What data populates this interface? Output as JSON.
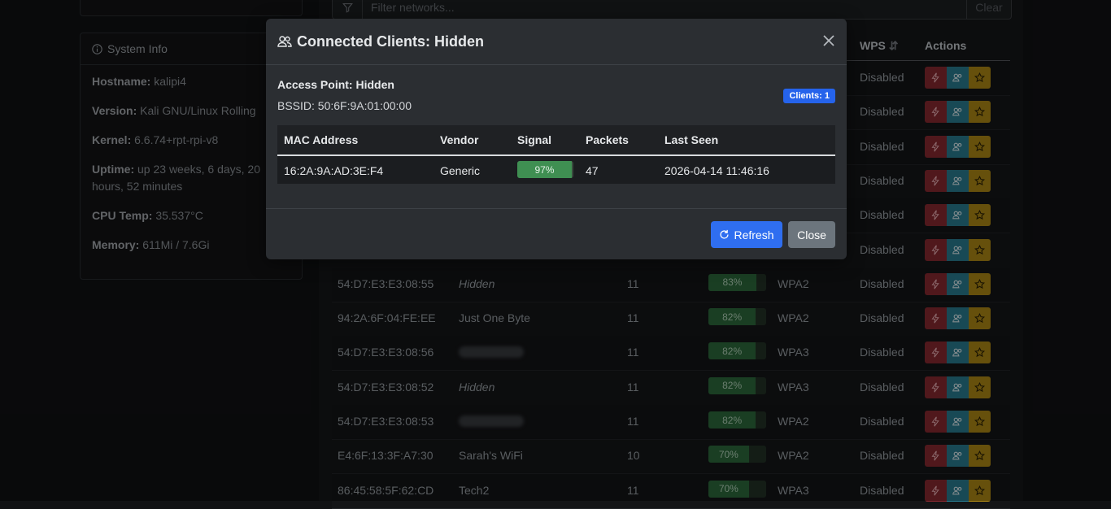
{
  "filter": {
    "placeholder": "Filter networks...",
    "clear_label": "Clear"
  },
  "sysinfo": {
    "title": "System Info",
    "rows": [
      {
        "label": "Hostname:",
        "value": "kalipi4"
      },
      {
        "label": "Version:",
        "value": "Kali GNU/Linux Rolling"
      },
      {
        "label": "Kernel:",
        "value": "6.6.74+rpt-rpi-v8"
      },
      {
        "label": "Uptime:",
        "value": "up 23 weeks, 6 days, 20 hours, 52 minutes"
      },
      {
        "label": "CPU Temp:",
        "value": "35.537°C"
      },
      {
        "label": "Memory:",
        "value": "611Mi / 7.6Gi"
      }
    ]
  },
  "table": {
    "headers": {
      "wps": "WPS",
      "actions": "Actions"
    },
    "rows_top": [
      {
        "wps": "Disabled"
      },
      {
        "wps": "Disabled"
      },
      {
        "wps": "Disabled"
      },
      {
        "wps": "Disabled"
      },
      {
        "wps": "Disabled"
      },
      {
        "wps": "Disabled"
      }
    ],
    "rows": [
      {
        "bssid": "54:D7:E3:E3:08:55",
        "ssid": "Hidden",
        "channel": "11",
        "signal": "83%",
        "signal_value": 83,
        "enc": "WPA2",
        "wps": "Disabled"
      },
      {
        "bssid": "94:2A:6F:04:FE:EE",
        "ssid": "Just One Byte",
        "channel": "11",
        "signal": "82%",
        "signal_value": 82,
        "enc": "WPA2",
        "wps": "Disabled"
      },
      {
        "bssid": "54:D7:E3:E3:08:56",
        "ssid": "",
        "channel": "11",
        "signal": "82%",
        "signal_value": 82,
        "enc": "WPA3",
        "wps": "Disabled"
      },
      {
        "bssid": "54:D7:E3:E3:08:52",
        "ssid": "Hidden",
        "channel": "11",
        "signal": "82%",
        "signal_value": 82,
        "enc": "WPA3",
        "wps": "Disabled"
      },
      {
        "bssid": "54:D7:E3:E3:08:53",
        "ssid": "",
        "channel": "11",
        "signal": "82%",
        "signal_value": 82,
        "enc": "WPA2",
        "wps": "Disabled"
      },
      {
        "bssid": "E4:6F:13:3F:A7:30",
        "ssid": "Sarah's WiFi",
        "channel": "10",
        "signal": "70%",
        "signal_value": 70,
        "enc": "WPA2",
        "wps": "Disabled"
      },
      {
        "bssid": "86:45:58:5F:62:CD",
        "ssid": "Tech2",
        "channel": "11",
        "signal": "70%",
        "signal_value": 70,
        "enc": "WPA3",
        "wps": "Disabled"
      }
    ]
  },
  "modal": {
    "title": "Connected Clients: Hidden",
    "ap_label": "Access Point: Hidden",
    "bssid_label": "BSSID: 50:6F:9A:01:00:00",
    "badge": "Clients: 1",
    "headers": {
      "mac": "MAC Address",
      "vendor": "Vendor",
      "signal": "Signal",
      "packets": "Packets",
      "last_seen": "Last Seen"
    },
    "client": {
      "mac": "16:2A:9A:AD:3E:F4",
      "vendor": "Generic",
      "signal": "97%",
      "signal_value": 97,
      "packets": "47",
      "last_seen": "2026-04-14 11:46:16"
    },
    "refresh_label": "Refresh",
    "close_label": "Close"
  },
  "colors": {
    "accent": "#2f6ef0",
    "danger": "#8a2a31",
    "info": "#2a7e93",
    "warning": "#b08a16",
    "signal_good": "#2d6b3d"
  }
}
